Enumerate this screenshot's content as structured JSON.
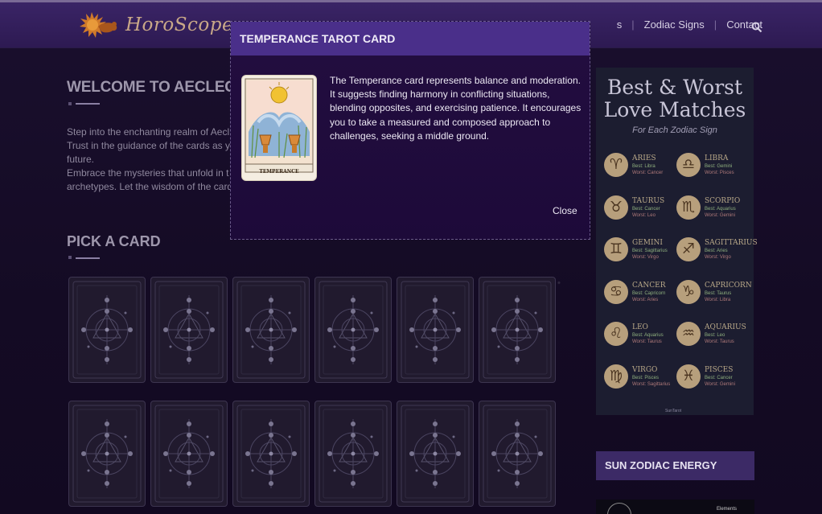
{
  "header": {
    "logo_text": "HoroScope",
    "nav": [
      {
        "label": "s",
        "partial": true
      },
      {
        "label": "Zodiac Signs"
      },
      {
        "label": "Contact"
      }
    ]
  },
  "main": {
    "welcome_title": "WELCOME TO AECLECT",
    "intro_lines": [
      "Step into the enchanting realm of Aecl",
      "Trust in the guidance of the cards as y",
      "future.",
      "Embrace the mysteries that unfold in t",
      "archetypes. Let the wisdom of the card"
    ],
    "pick_title": "PICK A CARD",
    "card_rows": 2,
    "cards_per_row": 6
  },
  "modal": {
    "title": "TEMPERANCE TAROT CARD",
    "card_caption": "TEMPERANCE",
    "description": "The Temperance card represents balance and moderation. It suggests finding harmony in conflicting situations, blending opposites, and exercising patience. It encourages you to take a measured and composed approach to challenges, seeking a middle ground.",
    "close_label": "Close"
  },
  "sidebar": {
    "love": {
      "title_line1": "Best & Worst",
      "title_line2": "Love Matches",
      "subtitle": "For Each Zodiac Sign",
      "signs": [
        {
          "name": "ARIES",
          "symbol": "♈",
          "best": "Best: Libra",
          "worst": "Worst: Cancer"
        },
        {
          "name": "LIBRA",
          "symbol": "♎",
          "best": "Best: Gemini",
          "worst": "Worst: Pisces"
        },
        {
          "name": "TAURUS",
          "symbol": "♉",
          "best": "Best: Cancer",
          "worst": "Worst: Leo"
        },
        {
          "name": "SCORPIO",
          "symbol": "♏",
          "best": "Best: Aquarius",
          "worst": "Worst: Gemini"
        },
        {
          "name": "GEMINI",
          "symbol": "♊",
          "best": "Best: Sagittarius",
          "worst": "Worst: Virgo"
        },
        {
          "name": "SAGITTARIUS",
          "symbol": "♐",
          "best": "Best: Aries",
          "worst": "Worst: Virgo"
        },
        {
          "name": "CANCER",
          "symbol": "♋",
          "best": "Best: Capricorn",
          "worst": "Worst: Aries"
        },
        {
          "name": "CAPRICORN",
          "symbol": "♑",
          "best": "Best: Taurus",
          "worst": "Worst: Libra"
        },
        {
          "name": "LEO",
          "symbol": "♌",
          "best": "Best: Aquarius",
          "worst": "Worst: Taurus"
        },
        {
          "name": "AQUARIUS",
          "symbol": "♒",
          "best": "Best: Leo",
          "worst": "Worst: Taurus"
        },
        {
          "name": "VIRGO",
          "symbol": "♍",
          "best": "Best: Pisces",
          "worst": "Worst: Sagittarius"
        },
        {
          "name": "PISCES",
          "symbol": "♓",
          "best": "Best: Cancer",
          "worst": "Worst: Gemini"
        }
      ],
      "footer": "SunTarot"
    },
    "sun_title": "SUN ZODIAC ENERGY",
    "sun_label": "Elements"
  },
  "colors": {
    "header_bg": "#3a2466",
    "modal_header": "#4a2f8a",
    "modal_bg": "#1e0c3d",
    "sign_circle": "#b79f7c"
  }
}
